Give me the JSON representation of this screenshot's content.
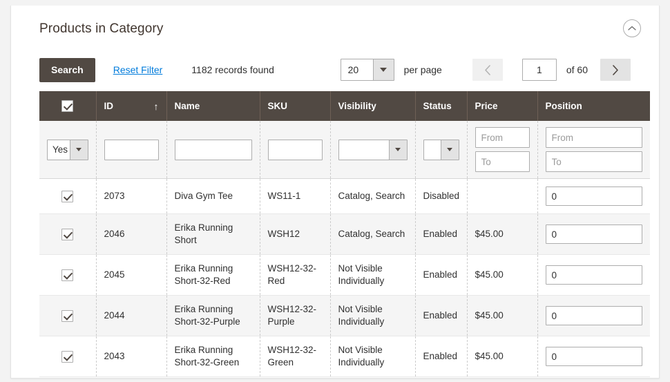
{
  "panel": {
    "title": "Products in Category",
    "collapse_icon": "chevron-up-circle-icon"
  },
  "toolbar": {
    "search_label": "Search",
    "reset_filter_label": "Reset Filter",
    "records_found": "1182 records found",
    "per_page_value": "20",
    "per_page_label": "per page",
    "prev_icon": "chevron-left-icon",
    "next_icon": "chevron-right-icon",
    "page_value": "1",
    "of_pages": "of 60"
  },
  "grid": {
    "columns": [
      {
        "key": "check",
        "label": "",
        "sort": ""
      },
      {
        "key": "id",
        "label": "ID",
        "sort": "asc"
      },
      {
        "key": "name",
        "label": "Name",
        "sort": ""
      },
      {
        "key": "sku",
        "label": "SKU",
        "sort": ""
      },
      {
        "key": "visibility",
        "label": "Visibility",
        "sort": ""
      },
      {
        "key": "status",
        "label": "Status",
        "sort": ""
      },
      {
        "key": "price",
        "label": "Price",
        "sort": ""
      },
      {
        "key": "position",
        "label": "Position",
        "sort": ""
      }
    ],
    "select_all_checked": true,
    "filters": {
      "check_select_value": "Yes",
      "id_value": "",
      "name_value": "",
      "sku_value": "",
      "visibility_value": "",
      "status_value": "",
      "price_from_placeholder": "From",
      "price_to_placeholder": "To",
      "position_from_placeholder": "From",
      "position_to_placeholder": "To",
      "price_from_value": "",
      "price_to_value": "",
      "position_from_value": "",
      "position_to_value": ""
    },
    "rows": [
      {
        "checked": true,
        "id": "2073",
        "name": "Diva Gym Tee",
        "sku": "WS11-1",
        "visibility": "Catalog, Search",
        "status": "Disabled",
        "price": "",
        "position": "0"
      },
      {
        "checked": true,
        "id": "2046",
        "name": "Erika Running Short",
        "sku": "WSH12",
        "visibility": "Catalog, Search",
        "status": "Enabled",
        "price": "$45.00",
        "position": "0"
      },
      {
        "checked": true,
        "id": "2045",
        "name": "Erika Running Short-32-Red",
        "sku": "WSH12-32-Red",
        "visibility": "Not Visible Individually",
        "status": "Enabled",
        "price": "$45.00",
        "position": "0"
      },
      {
        "checked": true,
        "id": "2044",
        "name": "Erika Running Short-32-Purple",
        "sku": "WSH12-32-Purple",
        "visibility": "Not Visible Individually",
        "status": "Enabled",
        "price": "$45.00",
        "position": "0"
      },
      {
        "checked": true,
        "id": "2043",
        "name": "Erika Running Short-32-Green",
        "sku": "WSH12-32-Green",
        "visibility": "Not Visible Individually",
        "status": "Enabled",
        "price": "$45.00",
        "position": "0"
      }
    ]
  },
  "colors": {
    "header_bar": "#514943",
    "link": "#007bdb",
    "text": "#303030",
    "title": "#41362f",
    "row_alt": "#f5f5f5",
    "filter_bg": "#f5f5f5",
    "button_bg": "#e3e3e3"
  }
}
